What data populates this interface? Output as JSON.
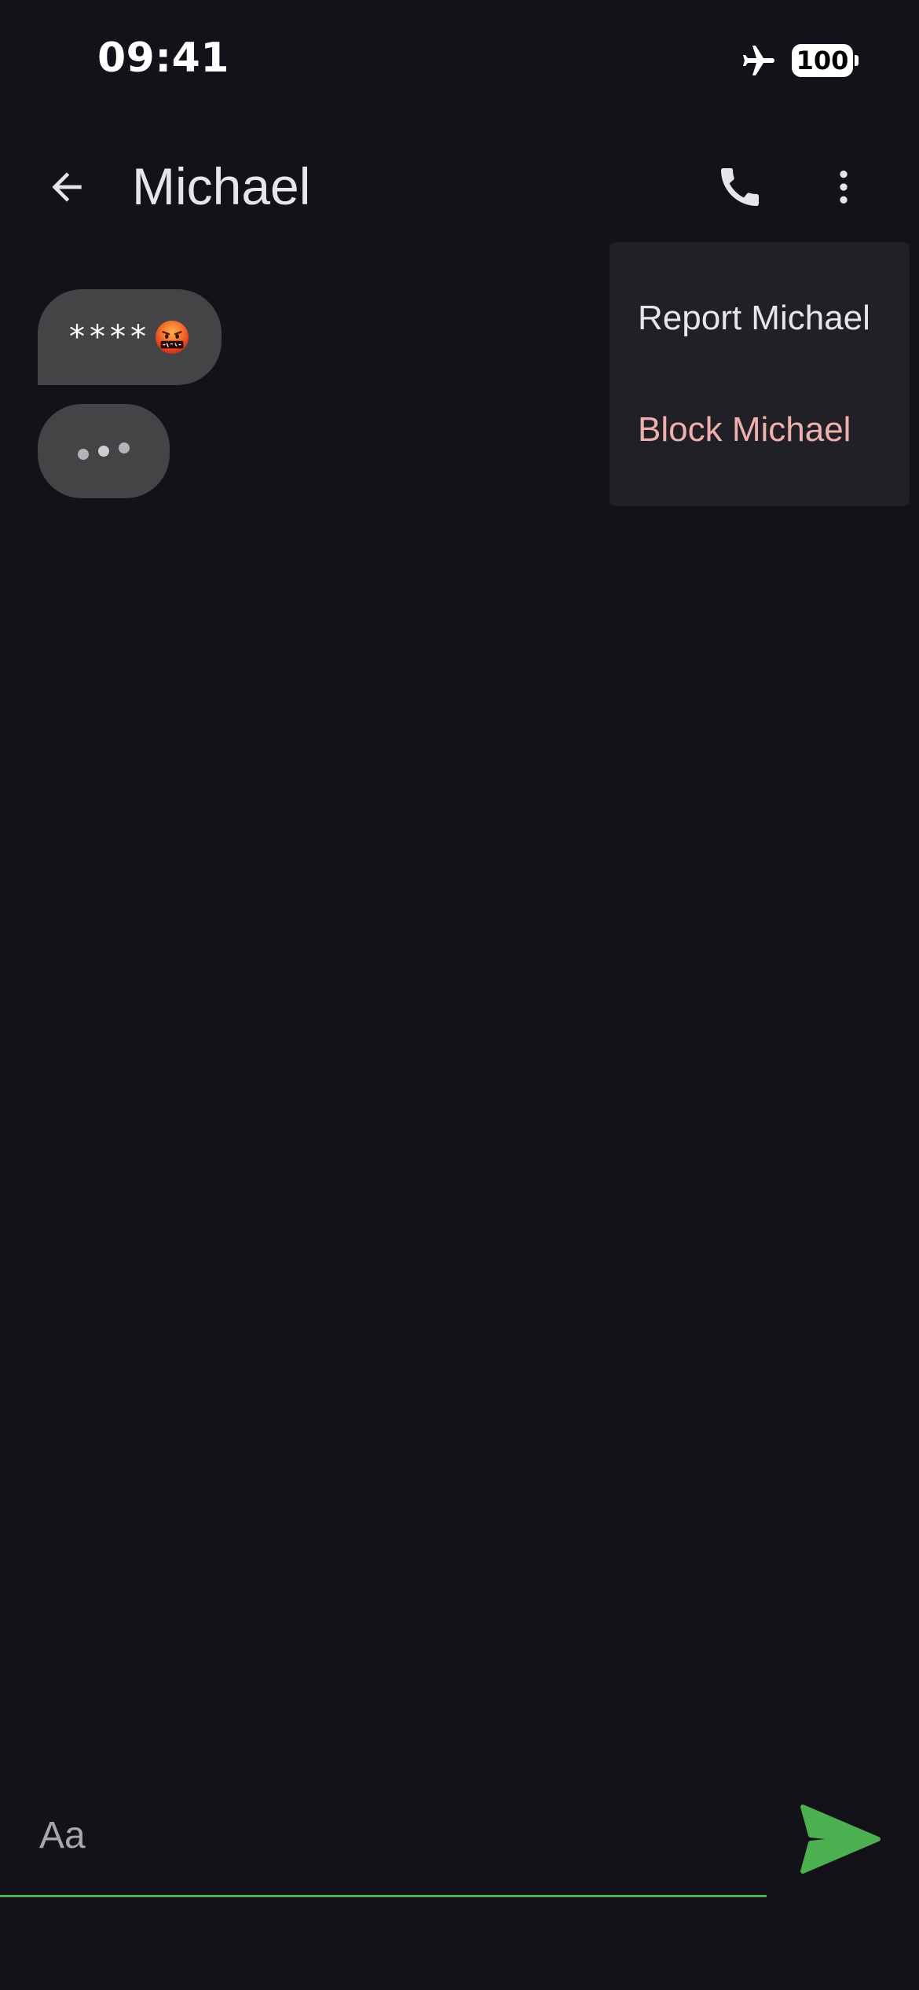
{
  "status_bar": {
    "time": "09:41",
    "battery": "100",
    "airplane_icon": "airplane-icon"
  },
  "header": {
    "title": "Michael",
    "back_icon": "arrow-left-icon",
    "call_icon": "phone-icon",
    "more_icon": "more-vertical-icon"
  },
  "messages": [
    {
      "text": "****",
      "emoji": "face-with-symbols-on-mouth"
    },
    {
      "text": "",
      "typing_indicator": true
    }
  ],
  "menu": {
    "items": [
      {
        "label": "Report Michael"
      },
      {
        "label": "Block Michael",
        "color": "#f0b0ae"
      }
    ]
  },
  "composer": {
    "placeholder": "Aa",
    "value": "",
    "send_icon": "send-icon",
    "accent_color": "#4caf50"
  },
  "colors": {
    "background": "#131218",
    "bubble": "#444446",
    "menu_background": "#212026",
    "accent": "#4caf50",
    "destructive": "#f0b0ae"
  }
}
